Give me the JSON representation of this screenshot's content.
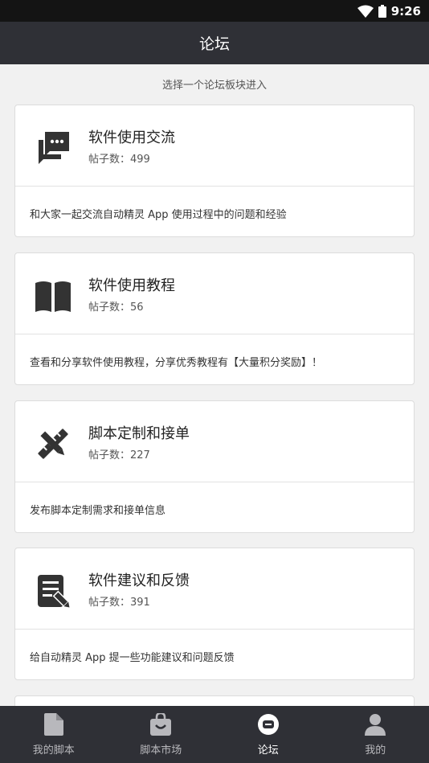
{
  "status": {
    "time": "9:26"
  },
  "header": {
    "title": "论坛"
  },
  "subtitle": "选择一个论坛板块进入",
  "sections": [
    {
      "title": "软件使用交流",
      "posts_label": "帖子数：",
      "posts": "499",
      "desc": "和大家一起交流自动精灵 App 使用过程中的问题和经验",
      "icon": "chat-bubbles-icon"
    },
    {
      "title": "软件使用教程",
      "posts_label": "帖子数：",
      "posts": "56",
      "desc": "查看和分享软件使用教程，分享优秀教程有【大量积分奖励】！",
      "icon": "open-book-icon"
    },
    {
      "title": "脚本定制和接单",
      "posts_label": "帖子数：",
      "posts": "227",
      "desc": "发布脚本定制需求和接单信息",
      "icon": "ruler-pencil-icon"
    },
    {
      "title": "软件建议和反馈",
      "posts_label": "帖子数：",
      "posts": "391",
      "desc": "给自动精灵 App 提一些功能建议和问题反馈",
      "icon": "document-edit-icon"
    }
  ],
  "nav": [
    {
      "label": "我的脚本",
      "icon": "document-icon"
    },
    {
      "label": "脚本市场",
      "icon": "shopping-bag-icon"
    },
    {
      "label": "论坛",
      "icon": "forum-icon"
    },
    {
      "label": "我的",
      "icon": "person-icon"
    }
  ],
  "colors": {
    "appbar": "#2f3036",
    "statusbar": "#141414",
    "background": "#f1f1f1",
    "icon": "#333333"
  }
}
